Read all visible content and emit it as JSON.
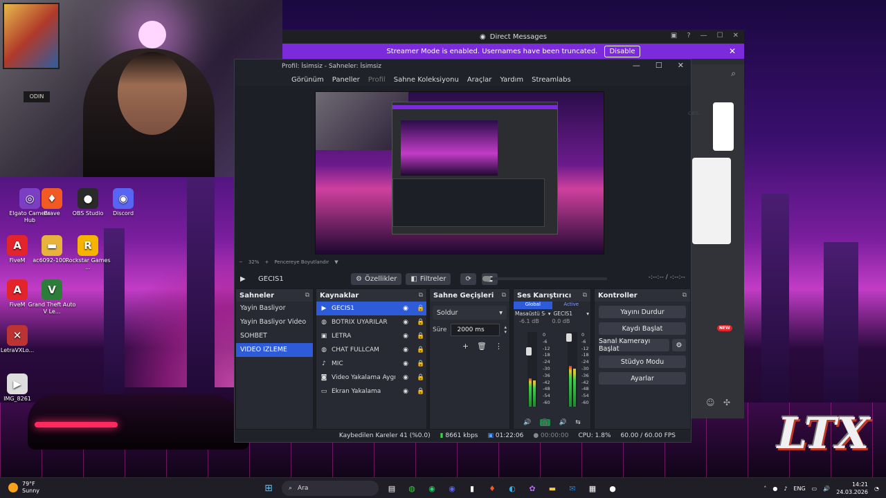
{
  "webcam": {
    "sign": "ODIN"
  },
  "desktop_icons": [
    {
      "label": "Elgato Camera Hub",
      "glyph": "◎",
      "color": "#7b3fc4"
    },
    {
      "label": "Brave",
      "glyph": "♦",
      "color": "#f15a22"
    },
    {
      "label": "OBS Studio",
      "glyph": "●",
      "color": "#2a2a2a"
    },
    {
      "label": "Discord",
      "glyph": "◉",
      "color": "#5865f2"
    },
    {
      "label": "FiveM",
      "glyph": "A",
      "color": "#e3242b"
    },
    {
      "label": "ac6092-100...",
      "glyph": "▬",
      "color": "#e8b33c"
    },
    {
      "label": "Rockstar Games ...",
      "glyph": "R",
      "color": "#f4b400"
    },
    {
      "label": "FiveM",
      "glyph": "A",
      "color": "#e3242b"
    },
    {
      "label": "Grand Theft Auto V Le...",
      "glyph": "V",
      "color": "#2d7d3a"
    },
    {
      "label": "LetraVXLo...",
      "glyph": "✕",
      "color": "#b33"
    },
    {
      "label": "IMG_8261",
      "glyph": "▶",
      "color": "#ddd"
    }
  ],
  "discord": {
    "title": "Direct Messages",
    "banner_text": "Streamer Mode is enabled. Usernames have been truncated.",
    "disable_label": "Disable",
    "partial_text": "ces.",
    "new_badge": "NEW"
  },
  "obs": {
    "title": "Profil: İsimsiz - Sahneler: İsimsiz",
    "menu": [
      "Görünüm",
      "Paneller",
      "Profil",
      "Sahne Koleksiyonu",
      "Araçlar",
      "Yardım",
      "Streamlabs"
    ],
    "zoom": "32%",
    "fit_label": "Pencereye Boyutlandır",
    "current_scene": "GECIS1",
    "properties_label": "Özellikler",
    "filters_label": "Filtreler",
    "time_display": "-:--:-- / -:--:--",
    "scenes_header": "Sahneler",
    "scenes": [
      "Yayin Basliyor",
      "Yayin Basliyor Video",
      "SOHBET",
      "VIDEO IZLEME"
    ],
    "selected_scene_index": 3,
    "sources_header": "Kaynaklar",
    "sources": [
      {
        "name": "GECIS1",
        "icon": "▶"
      },
      {
        "name": "BOTRIX UYARILAR",
        "icon": "◍"
      },
      {
        "name": "LETRA",
        "icon": "▣"
      },
      {
        "name": "CHAT FULLCAM",
        "icon": "◍"
      },
      {
        "name": "MIC",
        "icon": "♪"
      },
      {
        "name": "Video Yakalama Aygıtı",
        "icon": "◙"
      },
      {
        "name": "Ekran Yakalama",
        "icon": "▭"
      }
    ],
    "transitions_header": "Sahne Geçişleri",
    "transition_selected": "Soldur",
    "duration_label": "Süre",
    "duration_value": "2000 ms",
    "mixer_header": "Ses Karıştırıcı",
    "mixer_tab_global": "Global",
    "mixer_tab_active": "Active",
    "mixer_channels": [
      {
        "name": "Masaüstü Ses",
        "db": "-6.1 dB",
        "level": 0.38
      },
      {
        "name": "GECIS1",
        "db": "0.0 dB",
        "level": 0.55
      }
    ],
    "mixer_scale": [
      "0",
      "-6",
      "-12",
      "-18",
      "-24",
      "-30",
      "-36",
      "-42",
      "-48",
      "-54",
      "-60"
    ],
    "controls_header": "Kontroller",
    "controls": [
      "Yayını Durdur",
      "Kaydı Başlat",
      "Sanal Kamerayı Başlat",
      "Stüdyo Modu",
      "Ayarlar"
    ],
    "status": {
      "dropped": "Kaybedilen Kareler 41 (%0.0)",
      "bitrate": "8661 kbps",
      "stream_time": "01:22:06",
      "rec_time": "00:00:00",
      "cpu": "CPU: 1.8%",
      "fps": "60.00 / 60.00 FPS"
    }
  },
  "taskbar": {
    "temp": "79°F",
    "weather": "Sunny",
    "search_placeholder": "Ara",
    "lang": "ENG",
    "time": "14:21",
    "date": "24.03.2026"
  }
}
